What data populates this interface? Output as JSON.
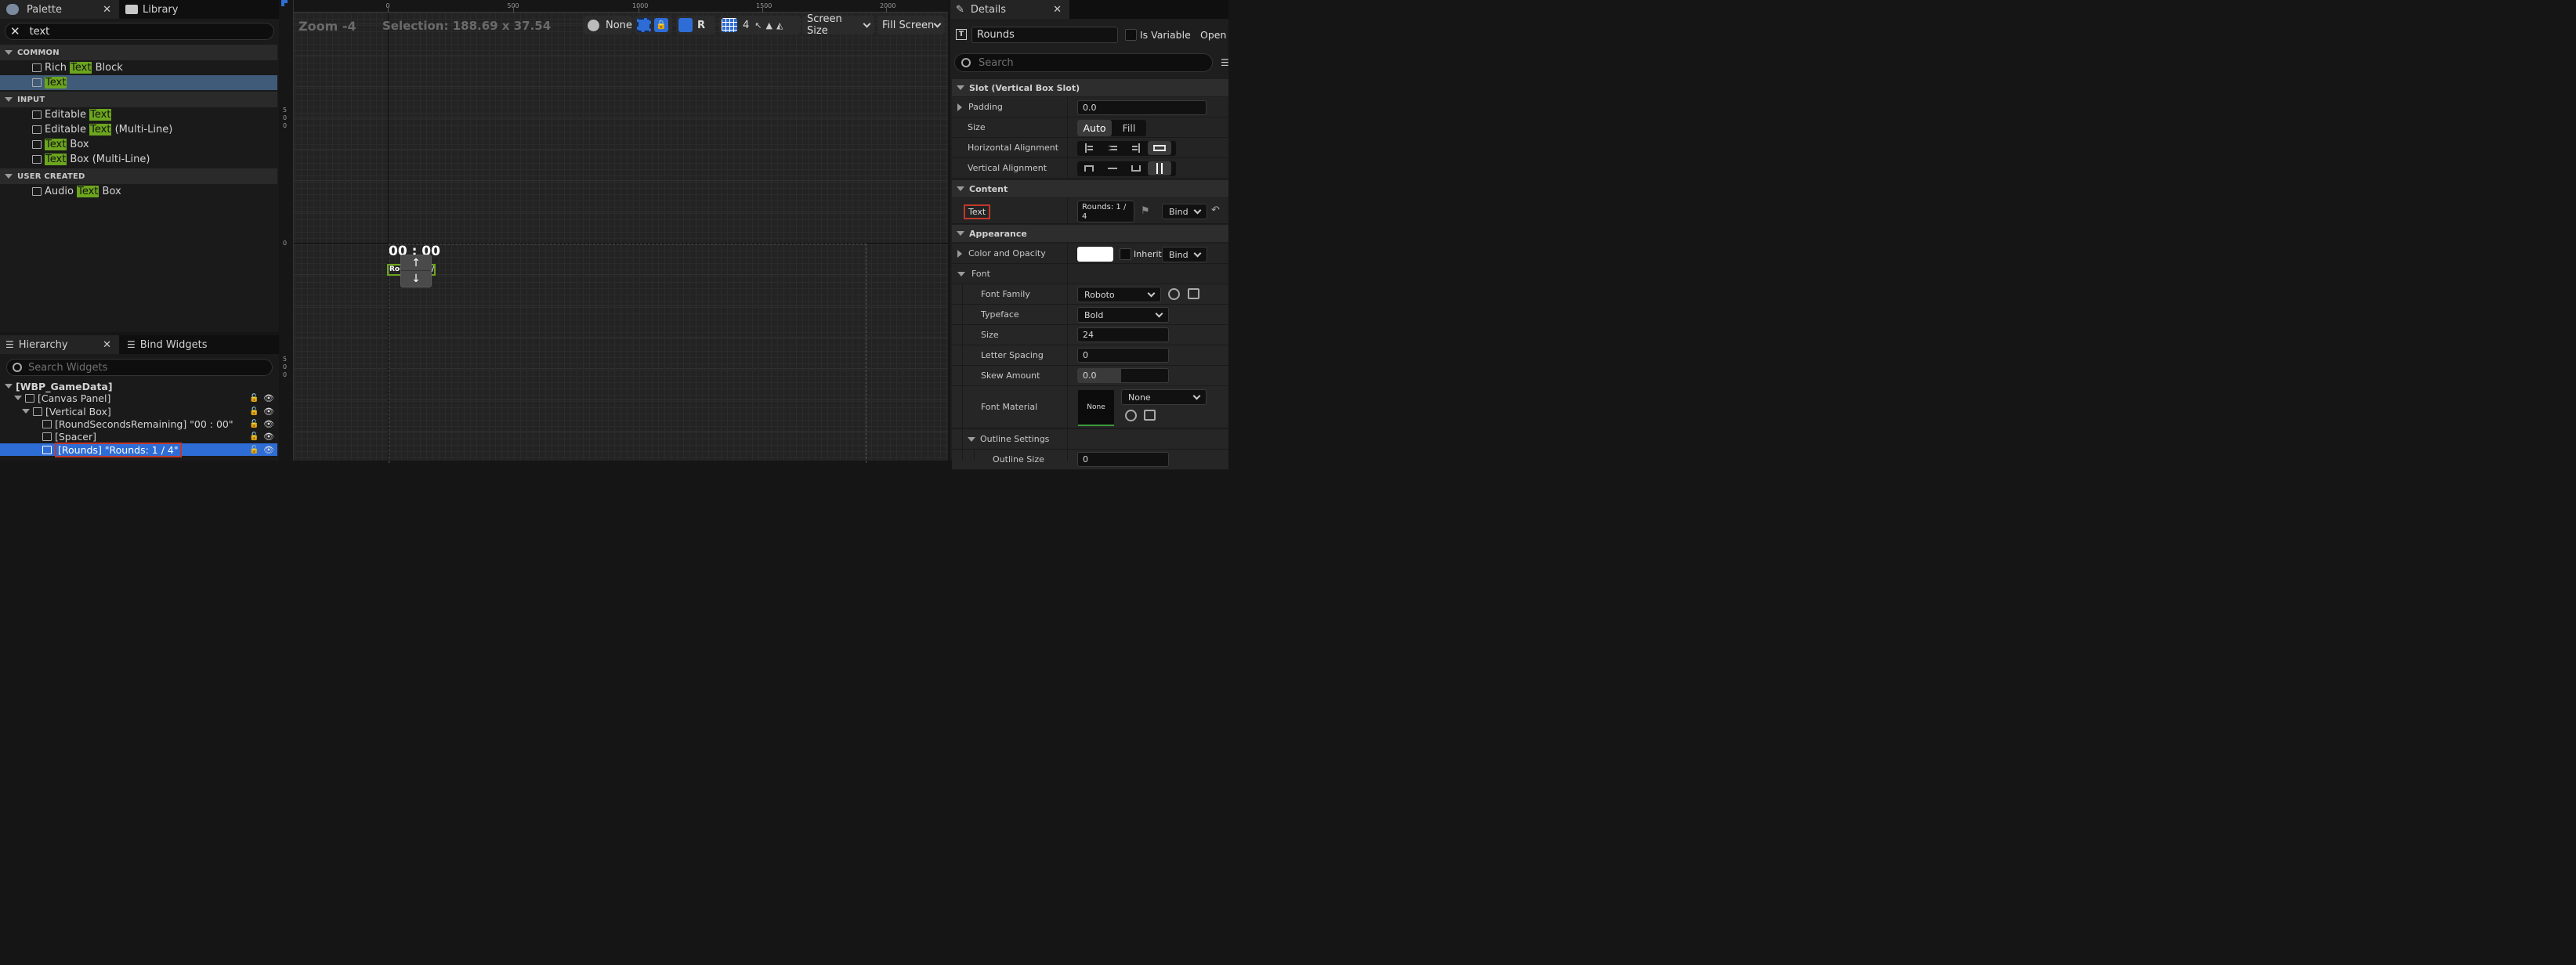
{
  "palette": {
    "tab_label": "Palette",
    "library_label": "Library",
    "search_value": "text",
    "categories": [
      {
        "label": "COMMON",
        "items": [
          {
            "pre": "Rich ",
            "hl": "Text",
            "post": " Block",
            "icon": "RT"
          },
          {
            "pre": "",
            "hl": "Text",
            "post": "",
            "icon": "T"
          }
        ]
      },
      {
        "label": "INPUT",
        "items": [
          {
            "pre": "Editable ",
            "hl": "Text",
            "post": "",
            "icon": "I"
          },
          {
            "pre": "Editable ",
            "hl": "Text",
            "post": " (Multi-Line)",
            "icon": "≡"
          },
          {
            "pre": "",
            "hl": "Text",
            "post": " Box",
            "icon": "I"
          },
          {
            "pre": "",
            "hl": "Text",
            "post": " Box (Multi-Line)",
            "icon": "≡"
          }
        ]
      },
      {
        "label": "USER CREATED",
        "items": [
          {
            "pre": "Audio ",
            "hl": "Text",
            "post": " Box",
            "icon": "⊞"
          }
        ]
      }
    ]
  },
  "hierarchy": {
    "tab_label": "Hierarchy",
    "bind_label": "Bind Widgets",
    "search_placeholder": "Search Widgets",
    "root": "[WBP_GameData]",
    "nodes": [
      "[Canvas Panel]",
      "[Vertical Box]",
      "[RoundSecondsRemaining] \"00 : 00\"",
      "[Spacer]",
      "[Rounds] \"Rounds: 1 / 4\""
    ]
  },
  "designer": {
    "zoom": "Zoom -4",
    "selection": "Selection: 188.69 x 37.54",
    "none_label": "None",
    "r_label": "R",
    "grid_value": "4",
    "screen_size": "Screen Size",
    "fill_screen": "Fill Screen",
    "ruler_h": [
      "0",
      "500",
      "1000",
      "1500",
      "2000"
    ],
    "ruler_v": [
      "500",
      "0",
      "500"
    ],
    "timer_text": "00 : 00",
    "rounds_text": "Rounds: 1 / 4"
  },
  "details": {
    "tab_label": "Details",
    "name_value": "Rounds",
    "is_variable": "Is Variable",
    "open_label": "Open T",
    "search_placeholder": "Search",
    "slot_header": "Slot (Vertical Box Slot)",
    "padding_label": "Padding",
    "padding_value": "0.0",
    "size_label": "Size",
    "size_auto": "Auto",
    "size_fill": "Fill",
    "halign_label": "Horizontal Alignment",
    "valign_label": "Vertical Alignment",
    "content_header": "Content",
    "text_label": "Text",
    "text_value": "Rounds: 1 / 4",
    "bind_label": "Bind",
    "appearance_header": "Appearance",
    "color_label": "Color and Opacity",
    "inherit_label": "Inherit",
    "font_header": "Font",
    "font_family_label": "Font Family",
    "font_family_value": "Roboto",
    "typeface_label": "Typeface",
    "typeface_value": "Bold",
    "font_size_label": "Size",
    "font_size_value": "24",
    "letter_spacing_label": "Letter Spacing",
    "letter_spacing_value": "0",
    "skew_label": "Skew Amount",
    "skew_value": "0.0",
    "material_label": "Font Material",
    "material_value": "None",
    "material_thumb": "None",
    "outline_header": "Outline Settings",
    "outline_size_label": "Outline Size",
    "outline_size_value": "0"
  },
  "colors": {
    "accent": "#2f6dd6",
    "highlight": "#6ca51e",
    "selection_red": "#c0392b"
  }
}
